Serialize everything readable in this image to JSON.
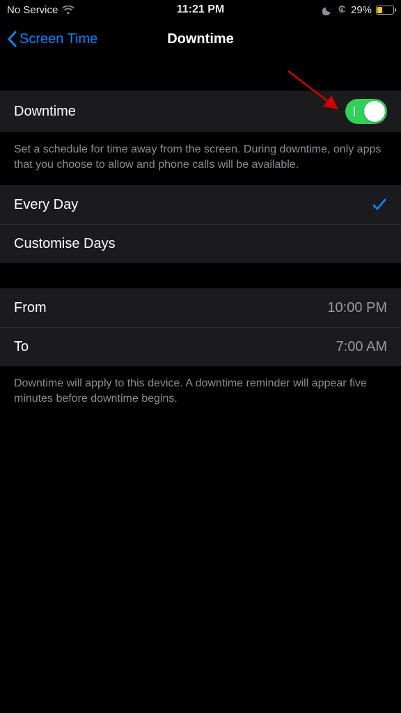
{
  "status": {
    "carrier": "No Service",
    "time": "11:21 PM",
    "battery_pct": "29%"
  },
  "nav": {
    "back_label": "Screen Time",
    "title": "Downtime"
  },
  "main_toggle": {
    "label": "Downtime",
    "on": true,
    "description": "Set a schedule for time away from the screen. During downtime, only apps that you choose to allow and phone calls will be available."
  },
  "schedule_mode": {
    "every_day_label": "Every Day",
    "every_day_selected": true,
    "customise_label": "Customise Days"
  },
  "times": {
    "from_label": "From",
    "from_value": "10:00 PM",
    "to_label": "To",
    "to_value": "7:00 AM"
  },
  "footer_note": "Downtime will apply to this device. A downtime reminder will appear five minutes before downtime begins.",
  "colors": {
    "accent": "#0a84ff",
    "toggle_on": "#30d158",
    "battery_low": "#ffcc00",
    "annotation_arrow": "#d40000"
  }
}
